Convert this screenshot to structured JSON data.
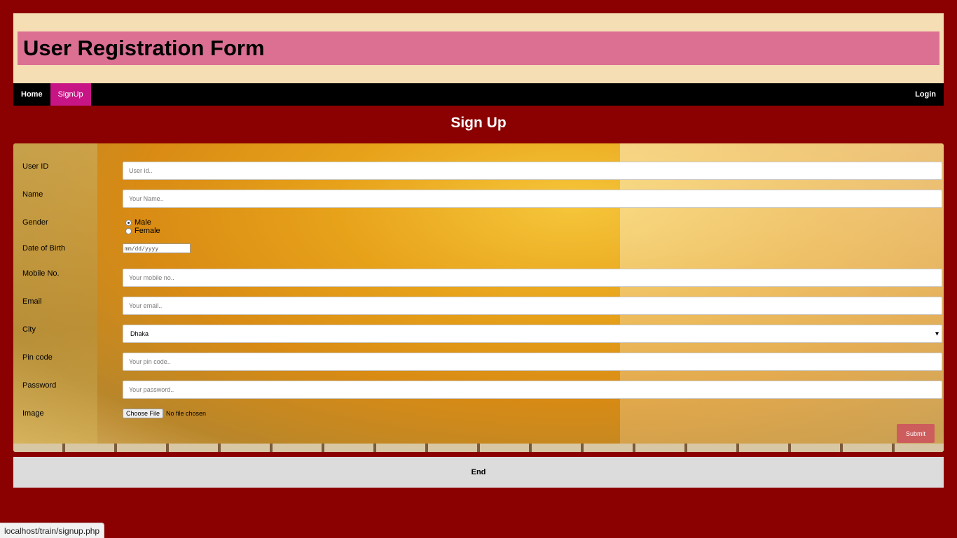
{
  "header": {
    "title": "User Registration Form"
  },
  "nav": {
    "home": "Home",
    "signup": "SignUp",
    "login": "Login"
  },
  "page_title": "Sign Up",
  "form": {
    "user_id": {
      "label": "User ID",
      "placeholder": "User id.."
    },
    "name": {
      "label": "Name",
      "placeholder": "Your Name.."
    },
    "gender": {
      "label": "Gender",
      "options": [
        "Male",
        "Female"
      ],
      "selected": "Male"
    },
    "dob": {
      "label": "Date of Birth",
      "placeholder": "mm/dd/yyyy"
    },
    "mobile": {
      "label": "Mobile No.",
      "placeholder": "Your mobile no.."
    },
    "email": {
      "label": "Email",
      "placeholder": "Your email.."
    },
    "city": {
      "label": "City",
      "value": "Dhaka"
    },
    "pin": {
      "label": "Pin code",
      "placeholder": "Your pin code.."
    },
    "password": {
      "label": "Password",
      "placeholder": "Your password.."
    },
    "image": {
      "label": "Image",
      "button": "Choose File",
      "status": "No file chosen"
    },
    "submit": "Submit"
  },
  "footer": {
    "text": "End"
  },
  "status_url": "localhost/train/signup.php",
  "colors": {
    "background": "#8b0000",
    "header": "#f5deb3",
    "title_band": "#db7093",
    "nav": "#000000",
    "active_tab": "#c71585",
    "submit": "#cd5c5c",
    "footer": "#dcdcdc"
  }
}
